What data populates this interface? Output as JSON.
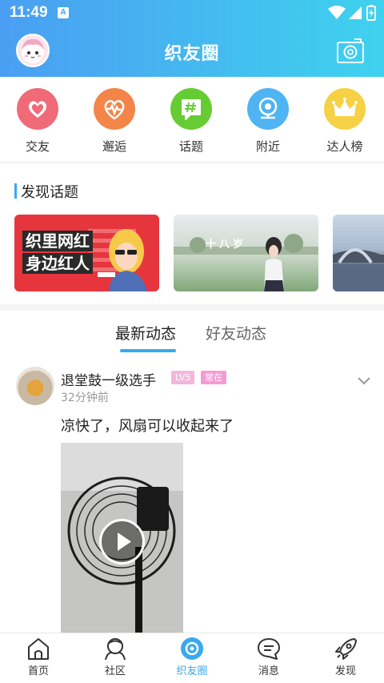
{
  "status": {
    "time": "11:49",
    "indicator": "A"
  },
  "header": {
    "title": "织友圈"
  },
  "quick_actions": [
    {
      "label": "交友",
      "icon": "heart-icon",
      "color": "#f06a78"
    },
    {
      "label": "邂逅",
      "icon": "pulse-icon",
      "color": "#f38548"
    },
    {
      "label": "话题",
      "icon": "hashtag-icon",
      "color": "#66cc33"
    },
    {
      "label": "附近",
      "icon": "location-icon",
      "color": "#4fb4f2"
    },
    {
      "label": "达人榜",
      "icon": "crown-icon",
      "color": "#f6d045"
    }
  ],
  "discover": {
    "title": "发现话题",
    "cards": [
      {
        "lines": [
          "织里网红",
          "身边红人"
        ]
      },
      {
        "caption": "十八岁"
      },
      {
        "caption": ""
      }
    ]
  },
  "tabs": [
    {
      "label": "最新动态",
      "active": true
    },
    {
      "label": "好友动态",
      "active": false
    }
  ],
  "post": {
    "username": "退堂鼓一级选手",
    "level": "LV5",
    "tag": "常在",
    "time": "32分钟前",
    "text": "凉快了，风扇可以收起来了"
  },
  "bottom_nav": [
    {
      "label": "首页",
      "icon": "home-icon",
      "active": false
    },
    {
      "label": "社区",
      "icon": "community-icon",
      "active": false
    },
    {
      "label": "织友圈",
      "icon": "circle-icon",
      "active": true
    },
    {
      "label": "消息",
      "icon": "message-icon",
      "active": false
    },
    {
      "label": "发现",
      "icon": "rocket-icon",
      "active": false
    }
  ],
  "colors": {
    "accent": "#39a9ef",
    "header_start": "#4a9ef2",
    "header_end": "#3fd2ee"
  }
}
